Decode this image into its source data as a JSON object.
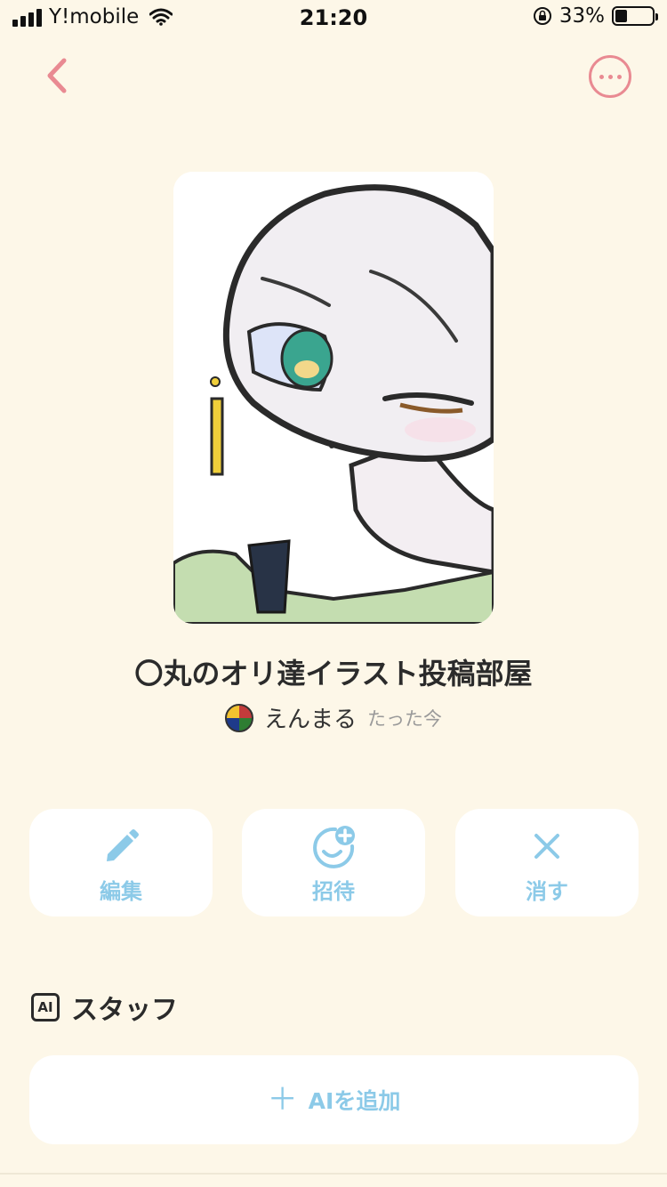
{
  "status_bar": {
    "carrier": "Y!mobile",
    "time": "21:20",
    "battery_percent": "33%",
    "battery_level": 0.33
  },
  "room": {
    "title": "〇丸のオリ達イラスト投稿部屋",
    "owner_name": "えんまる",
    "posted_time": "たった今"
  },
  "actions": {
    "edit_label": "編集",
    "invite_label": "招待",
    "delete_label": "消す"
  },
  "staff": {
    "badge": "AI",
    "title": "スタッフ",
    "add_label": "AIを追加"
  },
  "colors": {
    "background": "#fdf7e8",
    "accent_pink": "#e98a92",
    "accent_blue": "#8ccae8"
  }
}
